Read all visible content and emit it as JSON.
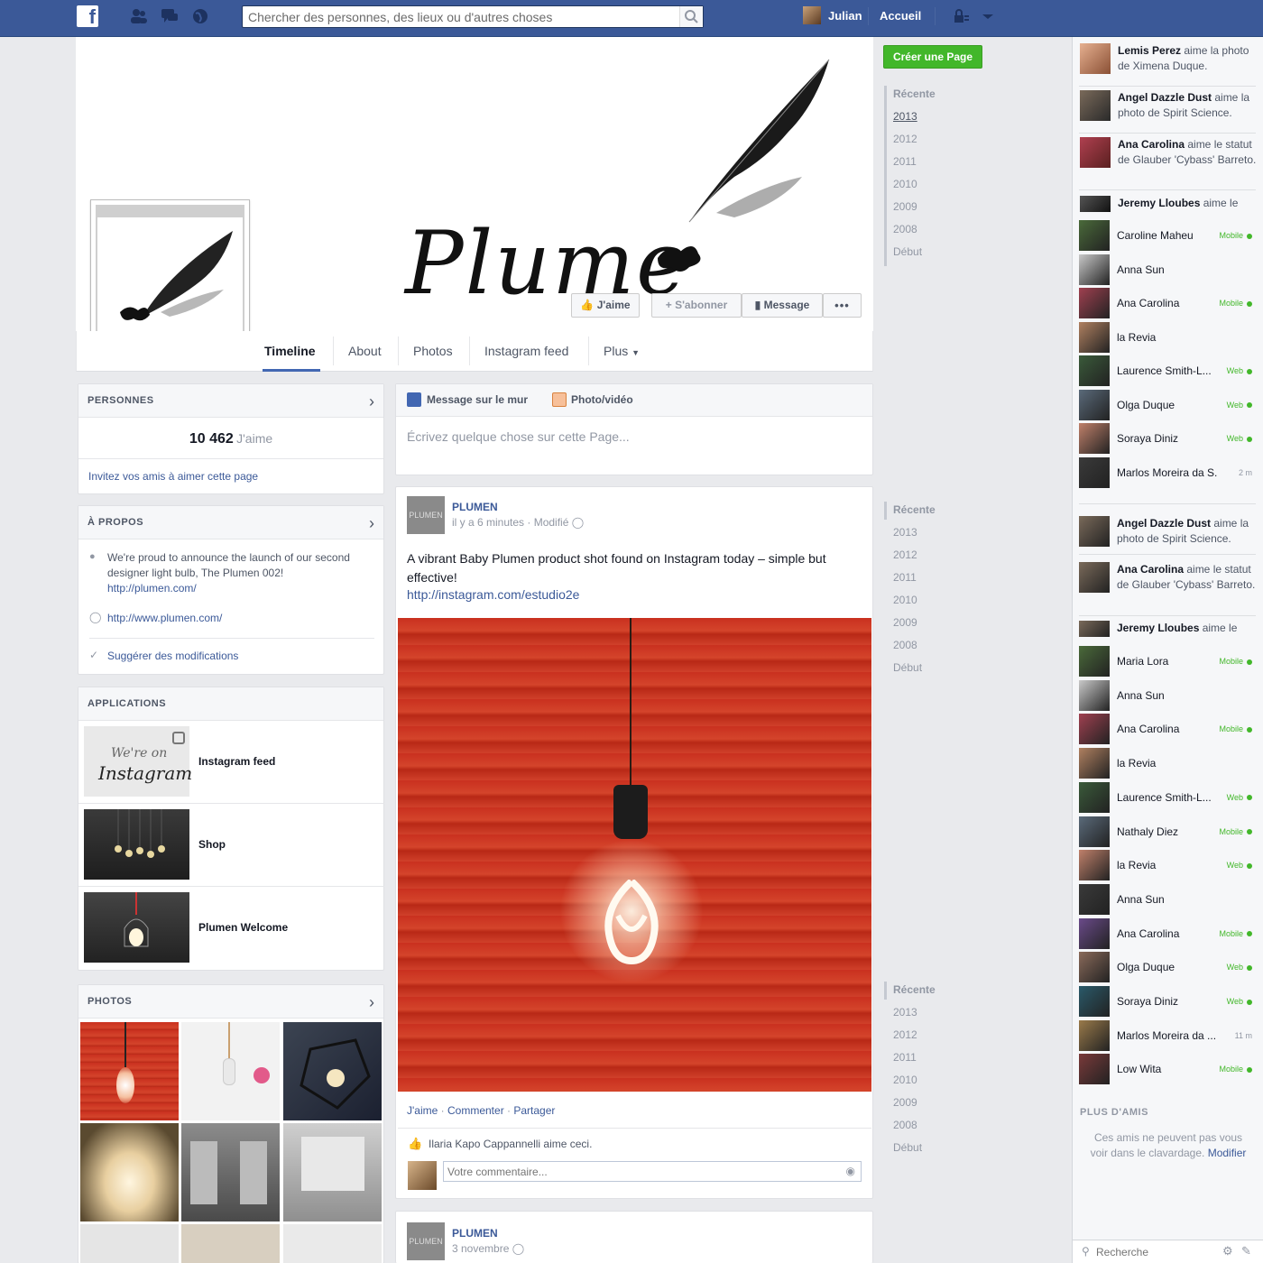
{
  "topbar": {
    "logo": "f",
    "search_placeholder": "Chercher des personnes, des lieux ou d'autres choses",
    "user_name": "Julian",
    "home_label": "Accueil",
    "icons": [
      "friends-icon",
      "messages-icon",
      "globe-icon",
      "search-icon",
      "privacy-icon",
      "dropdown-arrow-icon"
    ]
  },
  "cover": {
    "title": "Plume",
    "buttons": {
      "like": "J'aime",
      "follow": "S'abonner",
      "message": "Message",
      "more": "•••"
    }
  },
  "tabs": [
    "Timeline",
    "About",
    "Photos",
    "Instagram feed",
    "Plus"
  ],
  "create_page_button": "Créer une Page",
  "people": {
    "header": "PERSONNES",
    "count": "10 462",
    "count_label": "J'aime",
    "invite_link": "Invitez vos amis à aimer cette page"
  },
  "about": {
    "header": "À PROPOS",
    "description": "We're proud to announce the launch of our second designer light bulb, The Plumen 002!",
    "description_link": "http://plumen.com/",
    "website": "http://www.plumen.com/",
    "suggest": "Suggérer des modifications"
  },
  "applications": {
    "header": "APPLICATIONS",
    "items": [
      {
        "label": "Instagram feed",
        "thumb_line1": "We're on",
        "thumb_line2": "Instagram"
      },
      {
        "label": "Shop"
      },
      {
        "label": "Plumen Welcome"
      }
    ]
  },
  "photos": {
    "header": "PHOTOS"
  },
  "composer": {
    "tab_post": "Message sur le mur",
    "tab_photo": "Photo/vidéo",
    "placeholder": "Écrivez quelque chose sur cette Page..."
  },
  "post": {
    "author": "PLUMEN",
    "avatar_text": "PLUMEN",
    "meta": "il y a 6 minutes · Modifié",
    "text": "A vibrant Baby Plumen product shot found on Instagram today – simple but effective!",
    "link": "http://instagram.com/estudio2e",
    "actions": {
      "like": "J'aime",
      "comment": "Commenter",
      "share": "Partager"
    },
    "likes_text": "Ilaria Kapo Cappannelli aime ceci.",
    "comment_placeholder": "Votre commentaire..."
  },
  "post2": {
    "author": "PLUMEN",
    "avatar_text": "PLUMEN",
    "meta": "3 novembre"
  },
  "timeline_years": {
    "head": "Récente",
    "years": [
      "2013",
      "2012",
      "2011",
      "2010",
      "2009",
      "2008"
    ],
    "start": "Début"
  },
  "chat": {
    "ticker1": [
      {
        "name": "Lemis Perez",
        "action": " aime la photo de Ximena Duque."
      },
      {
        "name": "Angel Dazzle Dust",
        "action": " aime la photo de Spirit Science."
      },
      {
        "name": "Ana Carolina",
        "action": " aime le statut de Glauber 'Cybass' Barreto."
      },
      {
        "name": "Jeremy Lloubes",
        "action": " aime le"
      }
    ],
    "friends1": [
      {
        "name": "Caroline Maheu",
        "status": "Mobile"
      },
      {
        "name": "Anna Sun",
        "status": ""
      },
      {
        "name": "Ana Carolina",
        "status": "Mobile"
      },
      {
        "name": "la Revia",
        "status": ""
      },
      {
        "name": "Laurence Smith-L...",
        "status": "Web"
      },
      {
        "name": "Olga Duque",
        "status": "Web"
      },
      {
        "name": "Soraya Diniz",
        "status": "Web"
      },
      {
        "name": "Marlos Moreira da S...",
        "status": "2 m"
      }
    ],
    "ticker2": [
      {
        "name": "Angel Dazzle Dust",
        "action": " aime la photo de Spirit Science."
      },
      {
        "name": "Ana Carolina",
        "action": " aime le statut de Glauber 'Cybass' Barreto."
      },
      {
        "name": "Jeremy Lloubes",
        "action": " aime le"
      }
    ],
    "friends2": [
      {
        "name": "Maria Lora",
        "status": "Mobile"
      },
      {
        "name": "Anna Sun",
        "status": ""
      },
      {
        "name": "Ana Carolina",
        "status": "Mobile"
      },
      {
        "name": "la Revia",
        "status": ""
      },
      {
        "name": "Laurence Smith-L...",
        "status": "Web"
      },
      {
        "name": "Nathaly Diez",
        "status": "Mobile"
      },
      {
        "name": "la Revia",
        "status": "Web"
      },
      {
        "name": "Anna Sun",
        "status": ""
      },
      {
        "name": "Ana Carolina",
        "status": "Mobile"
      },
      {
        "name": "Olga Duque",
        "status": "Web"
      },
      {
        "name": "Soraya Diniz",
        "status": "Web"
      },
      {
        "name": "Marlos Moreira da ...",
        "status": "11 m"
      },
      {
        "name": "Low Wita",
        "status": "Mobile"
      }
    ],
    "more_friends_header": "PLUS D'AMIS",
    "more_friends_text": "Ces amis ne peuvent pas vous voir dans le clavardage.",
    "more_friends_link": "Modifier",
    "search_placeholder": "Recherche"
  }
}
